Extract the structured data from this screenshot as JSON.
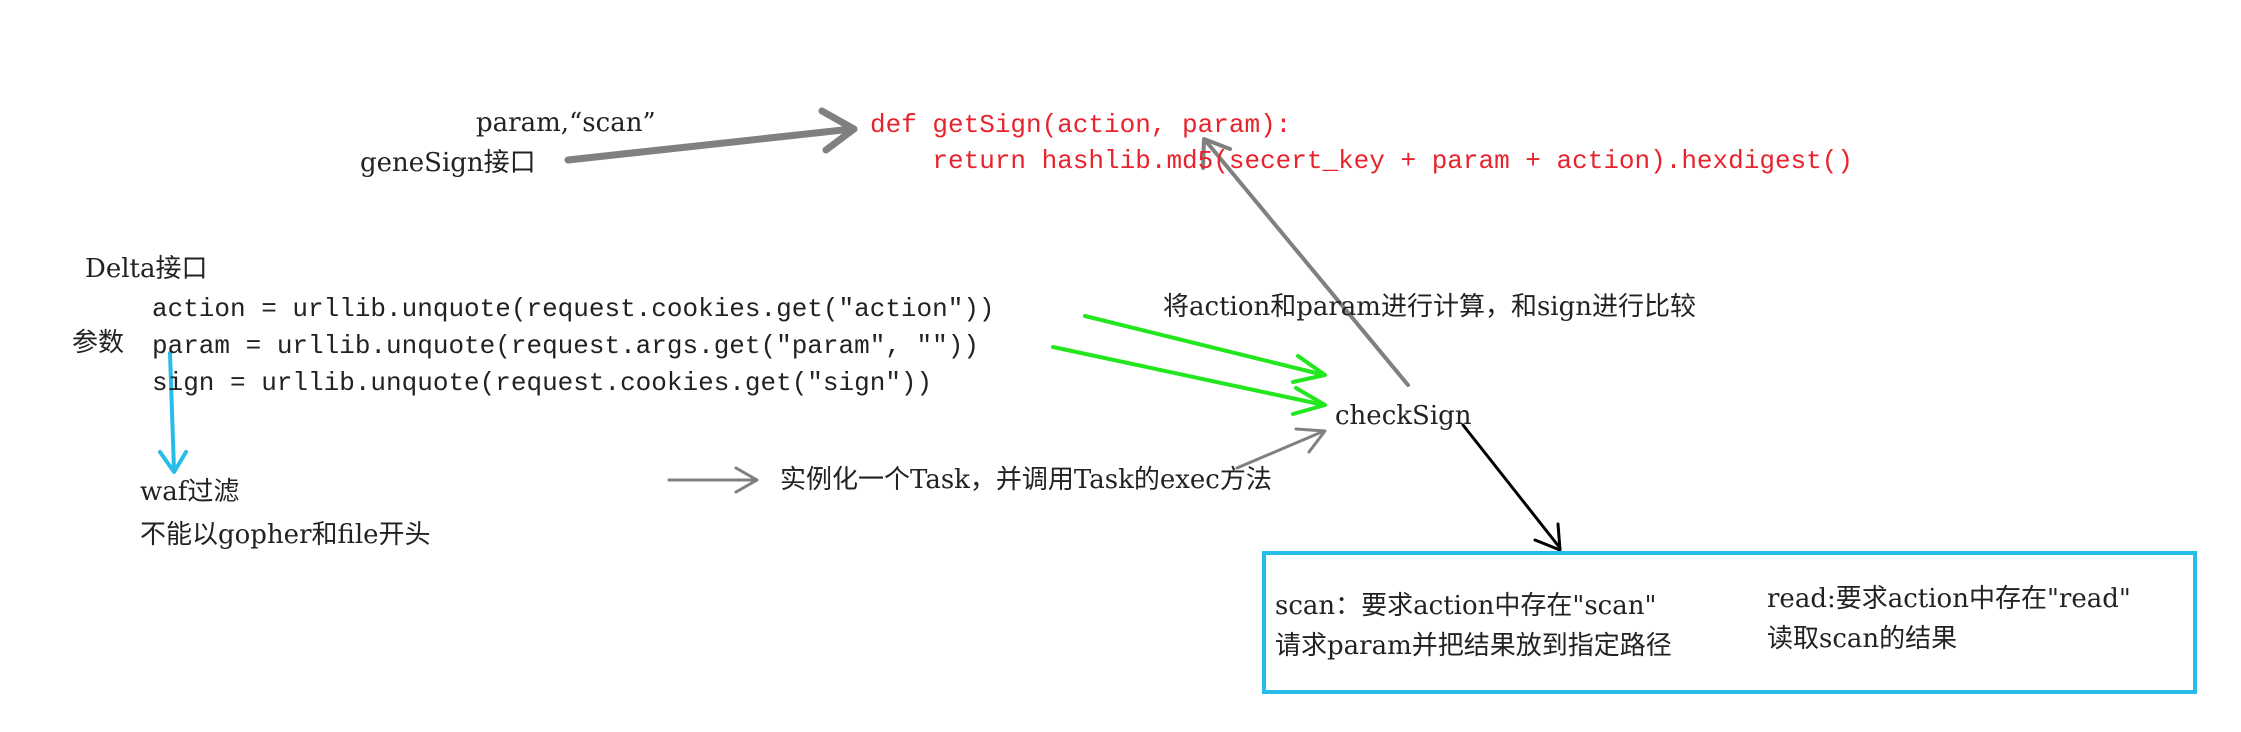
{
  "labels": {
    "param_scan": "param,“scan”",
    "genesign_api": "geneSign接口",
    "delta_api": "Delta接口",
    "params_label": "参数",
    "waf_filter": "waf过滤",
    "no_gopher_file": "不能以gopher和file开头",
    "instantiate_task": "实例化一个Task，并调用Task的exec方法",
    "compute_compare": "将action和param进行计算，和sign进行比较",
    "check_sign": "checkSign"
  },
  "code": {
    "def_line": "def getSign(action, param):",
    "return_line": "    return hashlib.md5(secert_key + param + action).hexdigest()",
    "action_line": "action = urllib.unquote(request.cookies.get(\"action\"))",
    "param_line": "param = urllib.unquote(request.args.get(\"param\", \"\"))",
    "sign_line": "sign = urllib.unquote(request.cookies.get(\"sign\"))"
  },
  "result_box": {
    "scan_line1": "scan：要求action中存在\"scan\"",
    "scan_line2": "请求param并把结果放到指定路径",
    "read_line1": "read:要求action中存在\"read\"",
    "read_line2": "读取scan的结果"
  },
  "colors": {
    "code_red": "#e8232d",
    "arrow_gray": "#808080",
    "arrow_green": "#22e61e",
    "arrow_blue": "#27bde8",
    "arrow_black": "#000000",
    "box_border": "#27bde8"
  }
}
